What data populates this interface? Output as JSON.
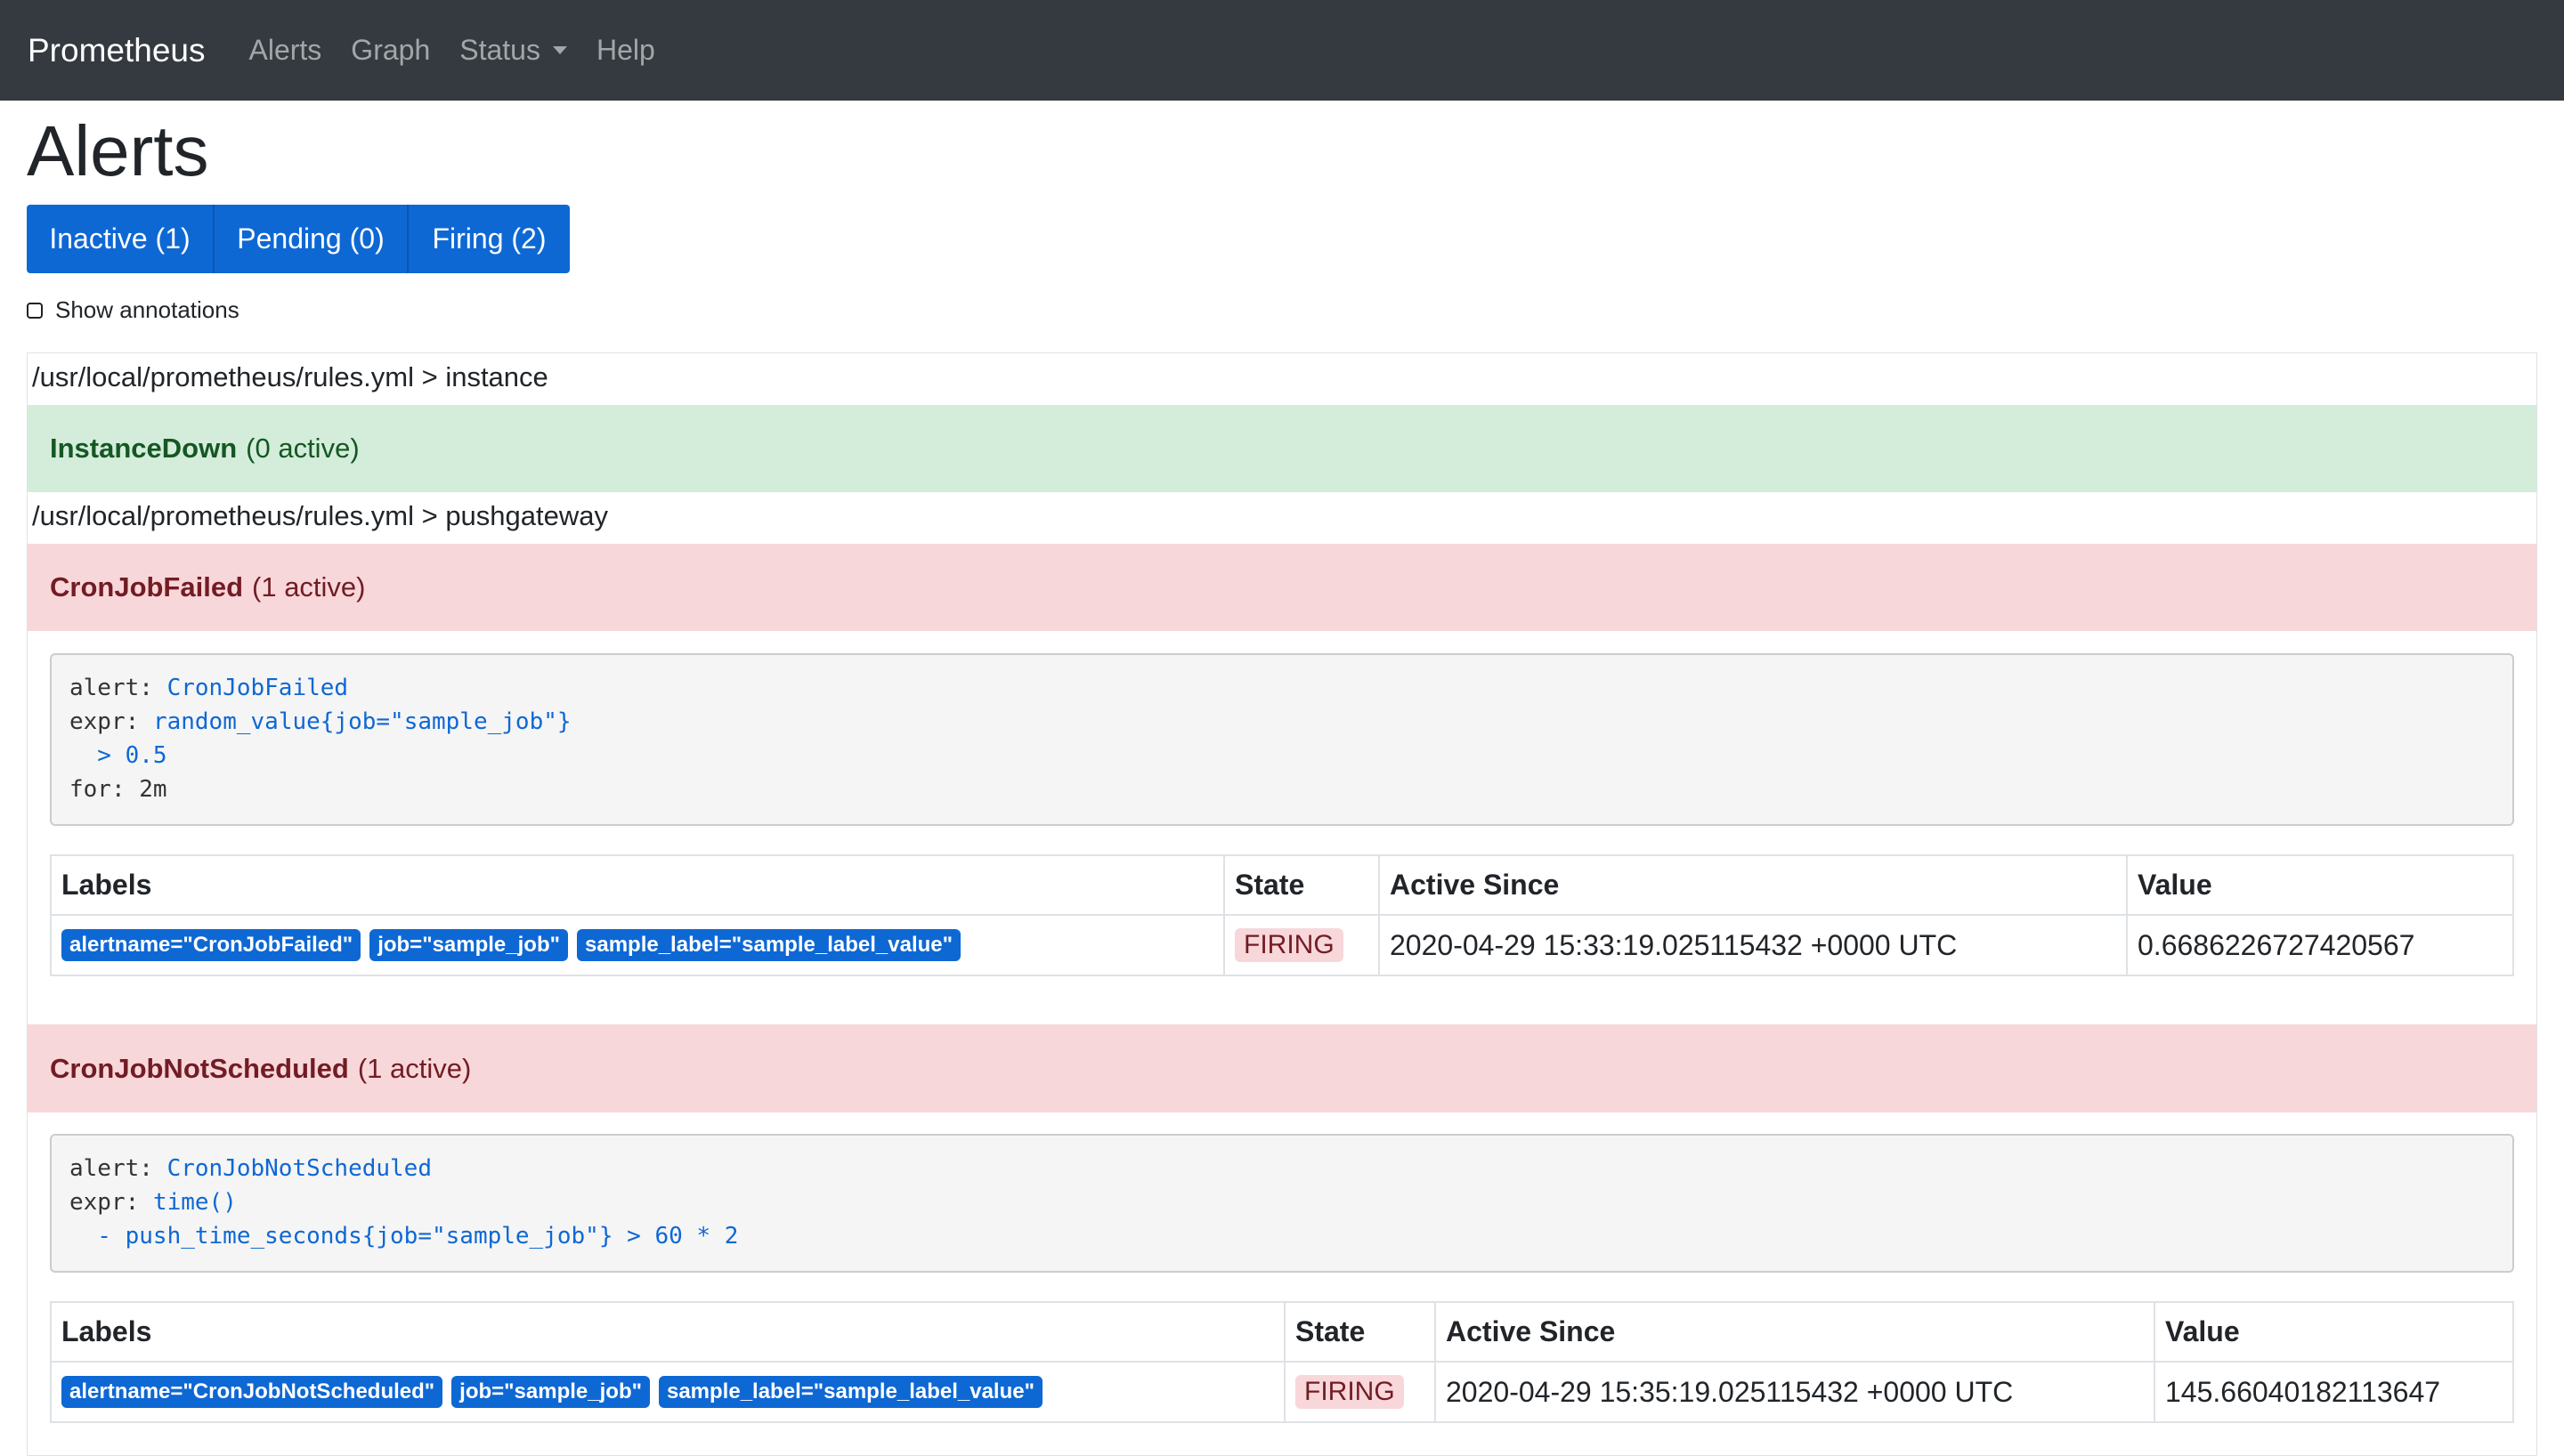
{
  "navbar": {
    "brand": "Prometheus",
    "items": [
      "Alerts",
      "Graph",
      "Status",
      "Help"
    ]
  },
  "page": {
    "title": "Alerts",
    "filters": [
      "Inactive (1)",
      "Pending (0)",
      "Firing (2)"
    ],
    "show_annotations": "Show annotations"
  },
  "groups": [
    {
      "path": "/usr/local/prometheus/rules.yml > instance",
      "rules": [
        {
          "name": "InstanceDown",
          "count": "(0 active)",
          "state": "inactive"
        }
      ]
    },
    {
      "path": "/usr/local/prometheus/rules.yml > pushgateway",
      "rules": [
        {
          "name": "CronJobFailed",
          "count": "(1 active)",
          "state": "firing",
          "definition": {
            "alert_key": "alert:",
            "alert_val": "CronJobFailed",
            "expr_key": "expr:",
            "expr_line1": "random_value{job=\"sample_job\"}",
            "expr_line2": "  > 0.5",
            "for_line": "for: 2m"
          },
          "table": {
            "headers": [
              "Labels",
              "State",
              "Active Since",
              "Value"
            ],
            "row": {
              "labels": [
                "alertname=\"CronJobFailed\"",
                "job=\"sample_job\"",
                "sample_label=\"sample_label_value\""
              ],
              "state": "FIRING",
              "active_since": "2020-04-29 15:33:19.025115432 +0000 UTC",
              "value": "0.6686226727420567"
            }
          }
        },
        {
          "name": "CronJobNotScheduled",
          "count": "(1 active)",
          "state": "firing",
          "definition": {
            "alert_key": "alert:",
            "alert_val": "CronJobNotScheduled",
            "expr_key": "expr:",
            "expr_line1": "time()",
            "expr_line2": "  - push_time_seconds{job=\"sample_job\"} > 60 * 2"
          },
          "table": {
            "headers": [
              "Labels",
              "State",
              "Active Since",
              "Value"
            ],
            "row": {
              "labels": [
                "alertname=\"CronJobNotScheduled\"",
                "job=\"sample_job\"",
                "sample_label=\"sample_label_value\""
              ],
              "state": "FIRING",
              "active_since": "2020-04-29 15:35:19.025115432 +0000 UTC",
              "value": "145.66040182113647"
            }
          }
        }
      ]
    }
  ],
  "colors": {
    "navbar_bg": "#343a40",
    "primary": "#0e68d4",
    "success_bg": "#d4edda",
    "success_text": "#155724",
    "danger_bg": "#f8d7da",
    "danger_text": "#721c24"
  }
}
